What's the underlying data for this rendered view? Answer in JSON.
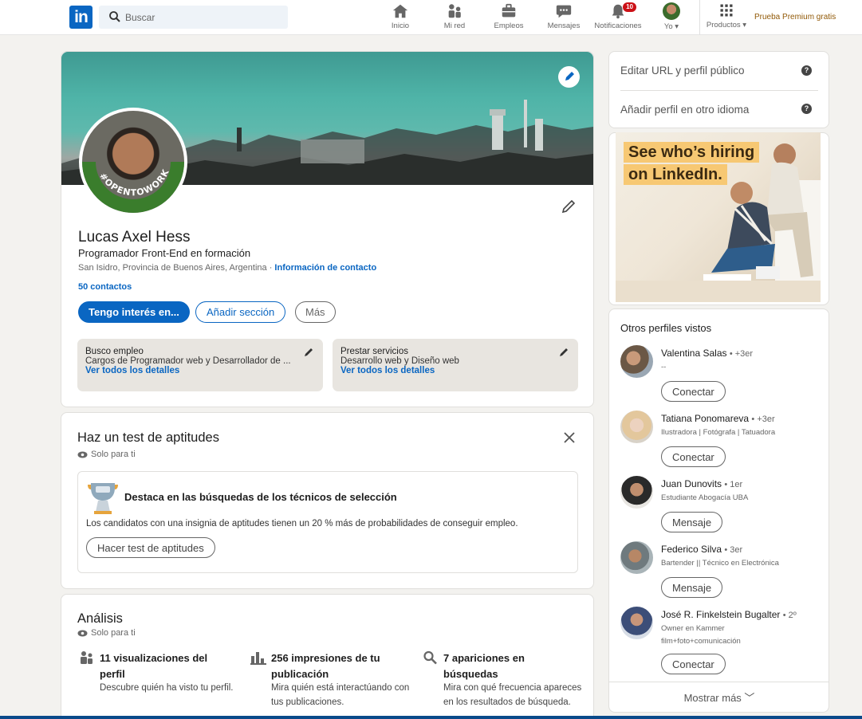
{
  "nav": {
    "logo": "in",
    "search_placeholder": "Buscar",
    "items": [
      {
        "label": "Inicio"
      },
      {
        "label": "Mi red"
      },
      {
        "label": "Empleos"
      },
      {
        "label": "Mensajes"
      },
      {
        "label": "Notificaciones",
        "badge": "10"
      },
      {
        "label": "Yo"
      },
      {
        "label": "Productos"
      }
    ],
    "premium": "Prueba Premium gratis"
  },
  "profile": {
    "photo_ring_text": "#OPENTOWORK",
    "name": "Lucas Axel Hess",
    "headline": "Programador Front-End en formación",
    "location": "San Isidro, Provincia de Buenos Aires, Argentina",
    "location_sep": " · ",
    "contact_link": "Información de contacto",
    "connections": "50 contactos",
    "btn_interest": "Tengo interés en...",
    "btn_add_section": "Añadir sección",
    "btn_more": "Más",
    "open_to_work": {
      "title": "Busco empleo",
      "desc": "Cargos de Programador web y Desarrollador de ...",
      "link": "Ver todos los detalles"
    },
    "services": {
      "title": "Prestar servicios",
      "desc": "Desarrollo web y Diseño web",
      "link": "Ver todos los detalles"
    }
  },
  "skills": {
    "title": "Haz un test de aptitudes",
    "privacy": "Solo para ti",
    "box_title": "Destaca en las búsquedas de los técnicos de selección",
    "box_text": "Los candidatos con una insignia de aptitudes tienen un 20 % más de probabilidades de conseguir empleo.",
    "button": "Hacer test de aptitudes"
  },
  "analytics": {
    "title": "Análisis",
    "privacy": "Solo para ti",
    "stats": [
      {
        "title": "11 visualizaciones del perfil",
        "desc": "Descubre quién ha visto tu perfil."
      },
      {
        "title": "256 impresiones de tu publicación",
        "desc": "Mira quién está interactúando con tus publicaciones."
      },
      {
        "title": "7 apariciones en búsquedas",
        "desc": "Mira con qué frecuencia apareces en los resultados de búsqueda."
      }
    ]
  },
  "right": {
    "edit_url": "Editar URL y perfil público",
    "add_language": "Añadir perfil en otro idioma",
    "ad": {
      "line1": "See who’s hiring",
      "line2": "on LinkedIn."
    },
    "people_title": "Otros perfiles vistos",
    "people": [
      {
        "name": "Valentina Salas",
        "degree": "• +3er",
        "sub": "--",
        "button": "Conectar"
      },
      {
        "name": "Tatiana Ponomareva",
        "degree": "• +3er",
        "sub": "Ilustradora | Fotógrafa | Tatuadora",
        "button": "Conectar"
      },
      {
        "name": "Juan Dunovits",
        "degree": "• 1er",
        "sub": "Estudiante Abogacía UBA",
        "button": "Mensaje"
      },
      {
        "name": "Federico Silva",
        "degree": "• 3er",
        "sub": "Bartender || Técnico en Electrónica",
        "button": "Mensaje"
      },
      {
        "name": "José R. Finkelstein Bugalter",
        "degree": "• 2º",
        "sub": "Owner en Kammer",
        "sub2": "film+foto+comunicación",
        "button": "Conectar"
      }
    ],
    "show_more": "Mostrar más"
  }
}
